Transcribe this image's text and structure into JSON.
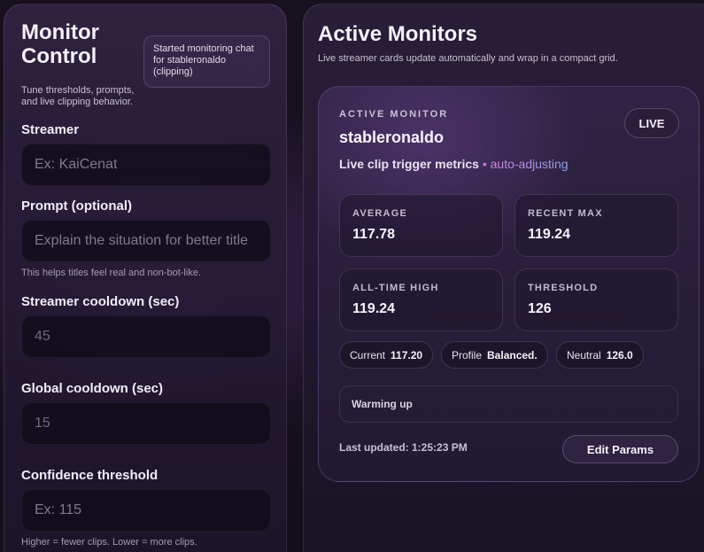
{
  "control": {
    "title": "Monitor Control",
    "subtitle": "Tune thresholds, prompts, and live clipping behavior.",
    "toast": "Started monitoring chat for stableronaldo (clipping)",
    "streamer": {
      "label": "Streamer",
      "placeholder": "Ex: KaiCenat"
    },
    "prompt": {
      "label": "Prompt (optional)",
      "placeholder": "Explain the situation for better title",
      "hint": "This helps titles feel real and non-bot-like."
    },
    "streamer_cooldown": {
      "label": "Streamer cooldown (sec)",
      "value": "45"
    },
    "global_cooldown": {
      "label": "Global cooldown (sec)",
      "value": "15"
    },
    "confidence": {
      "label": "Confidence threshold",
      "placeholder": "Ex: 115",
      "hint": "Higher = fewer clips. Lower = more clips."
    }
  },
  "monitors": {
    "title": "Active Monitors",
    "subtitle": "Live streamer cards update automatically and wrap in a compact grid.",
    "card": {
      "eyebrow": "ACTIVE MONITOR",
      "name": "stableronaldo",
      "badge": "LIVE",
      "metrics_text": "Live clip trigger metrics",
      "dot": "•",
      "mode": "auto-adjusting",
      "stats": [
        {
          "label": "AVERAGE",
          "value": "117.78"
        },
        {
          "label": "RECENT MAX",
          "value": "119.24"
        },
        {
          "label": "ALL-TIME HIGH",
          "value": "119.24"
        },
        {
          "label": "THRESHOLD",
          "value": "126"
        }
      ],
      "chips": [
        {
          "key": "Current",
          "value": "117.20"
        },
        {
          "key": "Profile",
          "value": "Balanced."
        },
        {
          "key": "Neutral",
          "value": "126.0"
        }
      ],
      "status": "Warming up",
      "last_updated": "Last updated: 1:25:23 PM",
      "edit_label": "Edit Params"
    }
  }
}
